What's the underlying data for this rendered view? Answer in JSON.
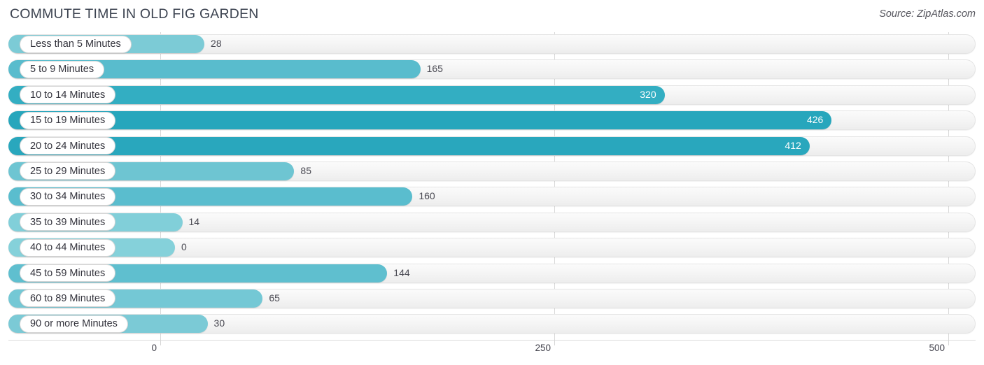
{
  "header": {
    "title": "COMMUTE TIME IN OLD FIG GARDEN",
    "source": "Source: ZipAtlas.com"
  },
  "chart_data": {
    "type": "bar",
    "orientation": "horizontal",
    "title": "COMMUTE TIME IN OLD FIG GARDEN",
    "xlabel": "",
    "ylabel": "",
    "xlim": [
      0,
      500
    ],
    "xticks": [
      0,
      250,
      500
    ],
    "xtick_labels": [
      "0",
      "250",
      "500"
    ],
    "grid": true,
    "legend": false,
    "categories": [
      "Less than 5 Minutes",
      "5 to 9 Minutes",
      "10 to 14 Minutes",
      "15 to 19 Minutes",
      "20 to 24 Minutes",
      "25 to 29 Minutes",
      "30 to 34 Minutes",
      "35 to 39 Minutes",
      "40 to 44 Minutes",
      "45 to 59 Minutes",
      "60 to 89 Minutes",
      "90 or more Minutes"
    ],
    "values": [
      28,
      165,
      320,
      426,
      412,
      85,
      160,
      14,
      0,
      144,
      65,
      30
    ],
    "value_labels": [
      "28",
      "165",
      "320",
      "426",
      "412",
      "85",
      "160",
      "14",
      "0",
      "144",
      "65",
      "30"
    ],
    "bar_colors": [
      "#7ccbd6",
      "#59bccd",
      "#33aec2",
      "#27a6bc",
      "#29a7bd",
      "#6ec5d2",
      "#5abdce",
      "#81cfd9",
      "#85d1da",
      "#5fbfcf",
      "#74c8d5",
      "#7bcad6"
    ],
    "label_inside": [
      false,
      false,
      true,
      true,
      true,
      false,
      false,
      false,
      false,
      false,
      false,
      false
    ]
  },
  "colors": {
    "accent_light": "#85d1da",
    "accent_dark": "#27a6bc",
    "track": "#f4f4f4",
    "text": "#3c3c46"
  }
}
